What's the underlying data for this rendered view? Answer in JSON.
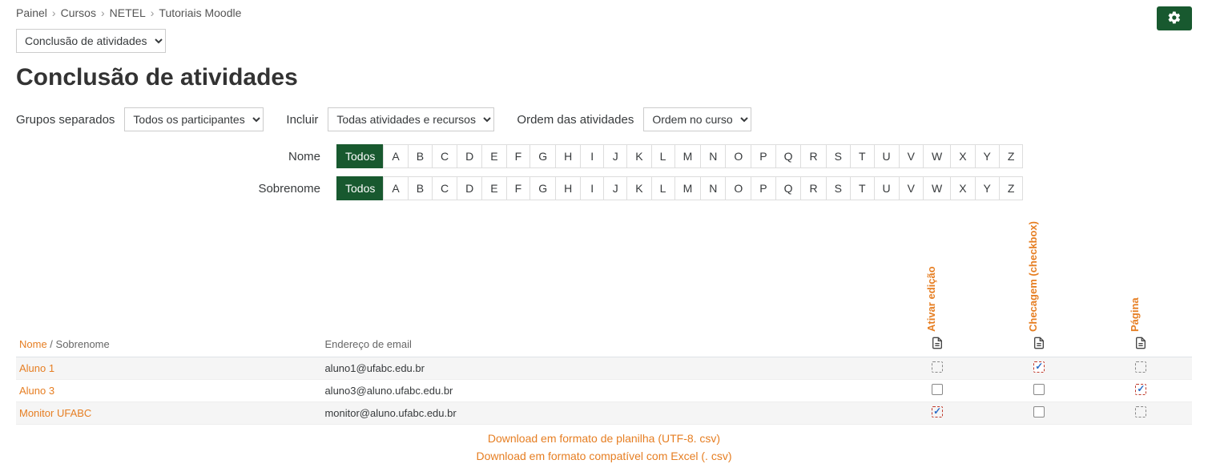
{
  "breadcrumb": [
    {
      "label": "Painel"
    },
    {
      "label": "Cursos"
    },
    {
      "label": "NETEL"
    },
    {
      "label": "Tutoriais Moodle"
    }
  ],
  "navSelect": {
    "selected": "Conclusão de atividades"
  },
  "pageTitle": "Conclusão de atividades",
  "filters": {
    "groups_label": "Grupos separados",
    "groups_value": "Todos os participantes",
    "include_label": "Incluir",
    "include_value": "Todas atividades e recursos",
    "order_label": "Ordem das atividades",
    "order_value": "Ordem no curso"
  },
  "alpha": {
    "name_label": "Nome",
    "surname_label": "Sobrenome",
    "all": "Todos",
    "letters": [
      "A",
      "B",
      "C",
      "D",
      "E",
      "F",
      "G",
      "H",
      "I",
      "J",
      "K",
      "L",
      "M",
      "N",
      "O",
      "P",
      "Q",
      "R",
      "S",
      "T",
      "U",
      "V",
      "W",
      "X",
      "Y",
      "Z"
    ]
  },
  "activities": [
    {
      "label": "Ativar edição",
      "type": "page"
    },
    {
      "label": "Checagem (checkbox)",
      "type": "page"
    },
    {
      "label": "Página",
      "type": "page"
    }
  ],
  "table": {
    "name_header": "Nome",
    "surname_header": "Sobrenome",
    "email_header": "Endereço de email",
    "separator": " / ",
    "rows": [
      {
        "name": "Aluno 1",
        "email": "aluno1@ufabc.edu.br",
        "completion": [
          "dashed",
          "checked-red",
          "dashed"
        ]
      },
      {
        "name": "Aluno 3",
        "email": "aluno3@aluno.ufabc.edu.br",
        "completion": [
          "solid",
          "solid",
          "checked-red-dash"
        ]
      },
      {
        "name": "Monitor UFABC",
        "email": "monitor@aluno.ufabc.edu.br",
        "completion": [
          "checked-red-dash",
          "solid",
          "dashed"
        ]
      }
    ]
  },
  "downloads": {
    "utf8": "Download em formato de planilha (UTF-8. csv)",
    "excel": "Download em formato compatível com Excel (. csv)"
  }
}
